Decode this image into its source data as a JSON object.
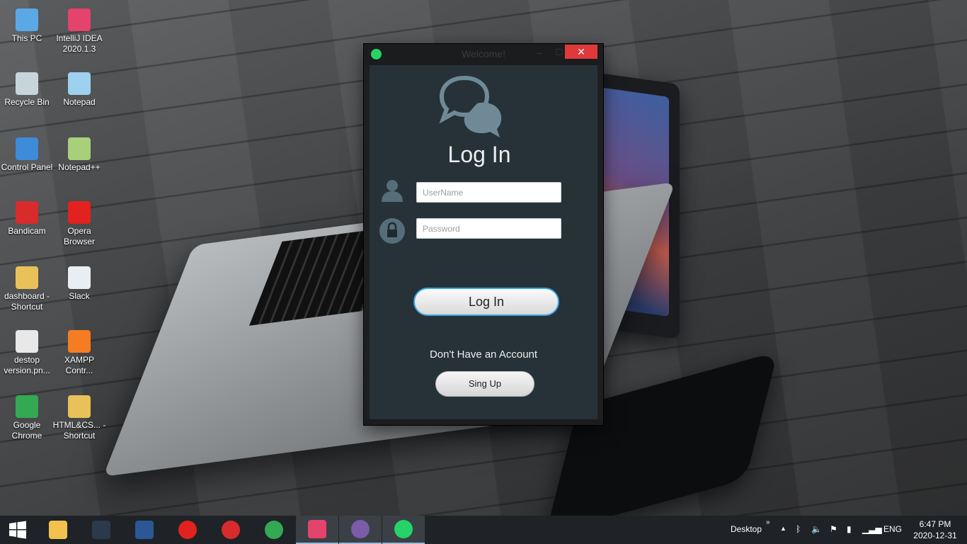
{
  "desktop": {
    "icons": [
      {
        "label": "This PC",
        "icon": "computer-icon",
        "color": "#5aa9e6"
      },
      {
        "label": "IntelliJ IDEA 2020.1.3",
        "icon": "intellij-icon",
        "color": "#e4436c"
      },
      {
        "label": "Recycle Bin",
        "icon": "recycle-bin-icon",
        "color": "#c7d4dc"
      },
      {
        "label": "Notepad",
        "icon": "notepad-icon",
        "color": "#9ed0ef"
      },
      {
        "label": "Control Panel",
        "icon": "control-panel-icon",
        "color": "#3d8bd9"
      },
      {
        "label": "Notepad++",
        "icon": "notepadpp-icon",
        "color": "#a8d07a"
      },
      {
        "label": "Bandicam",
        "icon": "bandicam-icon",
        "color": "#d92b2b"
      },
      {
        "label": "Opera Browser",
        "icon": "opera-icon",
        "color": "#e1221e"
      },
      {
        "label": "dashboard - Shortcut",
        "icon": "folder-icon",
        "color": "#e8c15a"
      },
      {
        "label": "Slack",
        "icon": "slack-icon",
        "color": "#e8eef3"
      },
      {
        "label": "destop version.pn...",
        "icon": "image-file-icon",
        "color": "#e8e8e8"
      },
      {
        "label": "XAMPP Contr...",
        "icon": "xampp-icon",
        "color": "#f57c22"
      },
      {
        "label": "Google Chrome",
        "icon": "chrome-icon",
        "color": "#34a853"
      },
      {
        "label": "HTML&CS... - Shortcut",
        "icon": "folder-icon",
        "color": "#e8c15a"
      }
    ]
  },
  "window": {
    "title": "Welcome!",
    "close_glyph": "✕",
    "min_glyph": "–",
    "max_glyph": "☐",
    "heading": "Log In",
    "username_placeholder": "UserName",
    "password_placeholder": "Password",
    "login_button": "Log In",
    "no_account_text": "Don't Have an Account",
    "signup_button": "Sing Up"
  },
  "taskbar": {
    "apps": [
      {
        "name": "file-explorer",
        "icon": "folder-icon",
        "color": "#f2c14e"
      },
      {
        "name": "mysql",
        "icon": "mysql-icon",
        "color": "#2b3a4a"
      },
      {
        "name": "word",
        "icon": "word-icon",
        "color": "#2b5797"
      },
      {
        "name": "opera",
        "icon": "opera-icon",
        "color": "#e1221e"
      },
      {
        "name": "bandicam",
        "icon": "record-icon",
        "color": "#d92b2b"
      },
      {
        "name": "chrome",
        "icon": "chrome-icon",
        "color": "#34a853"
      },
      {
        "name": "intellij",
        "icon": "intellij-icon",
        "color": "#e4436c"
      },
      {
        "name": "ring-app",
        "icon": "ring-icon",
        "color": "#7a5ca8"
      },
      {
        "name": "whatsapp",
        "icon": "whatsapp-icon",
        "color": "#25d366"
      }
    ],
    "desktop_label": "Desktop",
    "language": "ENG",
    "time": "6:47 PM",
    "date": "2020-12-31"
  }
}
